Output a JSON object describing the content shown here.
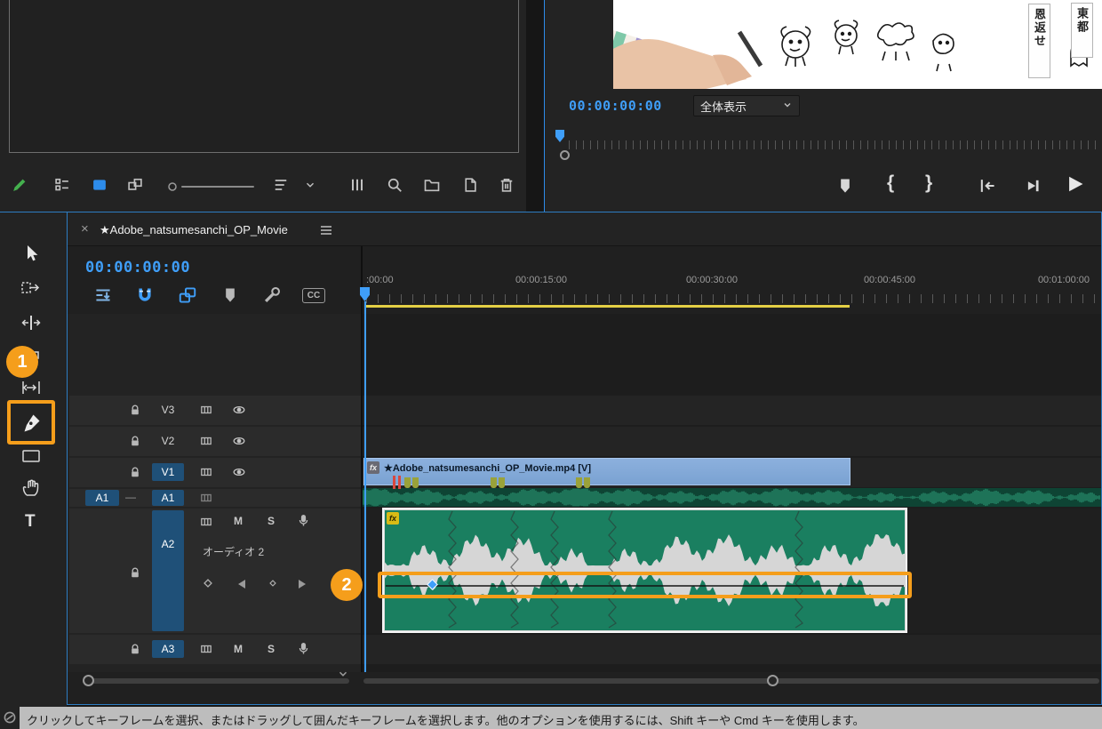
{
  "program_monitor": {
    "timecode": "00:00:00:00",
    "fit_label": "全体表示",
    "paper_notes": [
      "恩返せ",
      "東都"
    ],
    "transport": {
      "mark_in": "{",
      "mark_out": "}"
    }
  },
  "timeline": {
    "tab": {
      "close": "×",
      "title": "★Adobe_natsumesanchi_OP_Movie"
    },
    "timecode": "00:00:00:00",
    "captions_label": "CC",
    "ruler_ticks": [
      ":00:00",
      "00:00:15:00",
      "00:00:30:00",
      "00:00:45:00",
      "00:01:00:00"
    ],
    "tracks": {
      "v3": "V3",
      "v2": "V2",
      "v1": "V1",
      "a1_patch": "A1",
      "a1_dash": "—",
      "a1": "A1",
      "a2": "A2",
      "a2_name": "オーディオ 2",
      "a3": "A3",
      "mute": "M",
      "solo": "S"
    },
    "v1_clip": {
      "fx_badge": "fx",
      "label": "★Adobe_natsumesanchi_OP_Movie.mp4 [V]"
    },
    "a2_clip": {
      "fx_badge": "fx"
    }
  },
  "tools": {
    "type_label": "T"
  },
  "annotations": {
    "step1": "1",
    "step2": "2"
  },
  "status_bar": {
    "message": "クリックしてキーフレームを選択、またはドラッグして囲んだキーフレームを選択します。他のオプションを使用するには、Shift キーや Cmd キーを使用します。"
  }
}
